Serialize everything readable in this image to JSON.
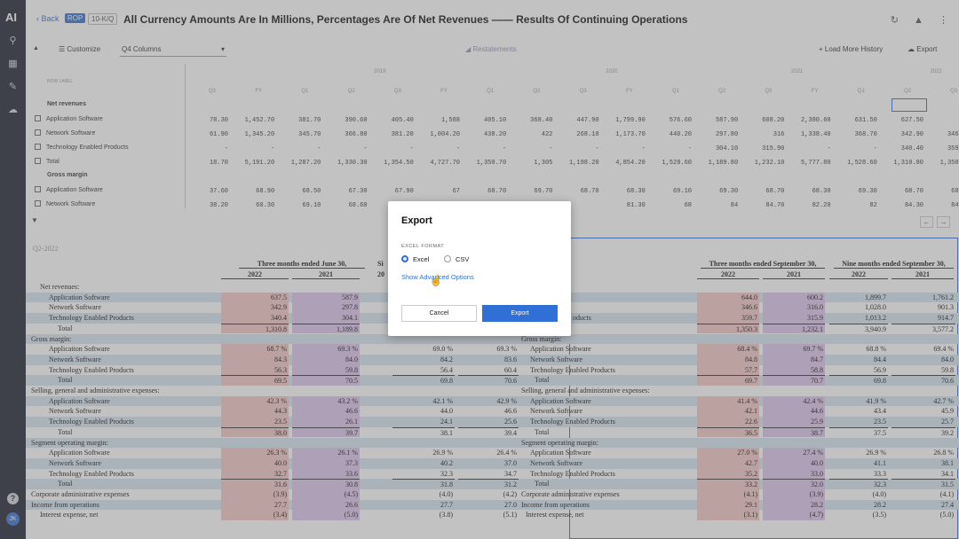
{
  "rail": {
    "logo": "AI",
    "avatar": "JK",
    "help": "?"
  },
  "topbar": {
    "back": "Back",
    "badge1": "ROP",
    "badge2": "10-K/Q",
    "title": "All Currency Amounts Are In Millions, Percentages Are Of Net Revenues —— Results Of Continuing Operations"
  },
  "toolbar": {
    "customize": "Customize",
    "columns": "Q4 Columns",
    "restatements": "Restatements",
    "load_history": "Load More History",
    "export": "Export"
  },
  "grid": {
    "row_label_header": "ROW LABEL",
    "years": [
      "2019",
      "2020",
      "2021",
      "2022"
    ],
    "period_headers": [
      "Q3",
      "FY",
      "Q1",
      "Q2",
      "Q3",
      "FY",
      "Q1",
      "Q2",
      "Q3",
      "FY",
      "Q1",
      "Q2",
      "Q3",
      "FY",
      "Q1",
      "Q2",
      "Q3"
    ],
    "rows": [
      {
        "label": "Net revenues",
        "header": true,
        "cells": []
      },
      {
        "label": "Application Software",
        "header": false,
        "cells": [
          "78.30",
          "1,452.70",
          "381.70",
          "390.60",
          "405.40",
          "1,588",
          "405.10",
          "368.40",
          "447.90",
          "1,799.90",
          "576.60",
          "587.90",
          "608.20",
          "2,380.60",
          "631.50",
          "627.50",
          "644"
        ]
      },
      {
        "label": "Network Software",
        "header": false,
        "cells": [
          "61.90",
          "1,345.20",
          "345.70",
          "366.80",
          "381.20",
          "1,004.20",
          "438.20",
          "422",
          "268.10",
          "1,173.70",
          "440.20",
          "297.80",
          "316",
          "1,338.40",
          "368.70",
          "342.90",
          "346.60"
        ]
      },
      {
        "label": "Technology Enabled Products",
        "header": false,
        "cells": [
          "-",
          "-",
          "-",
          "-",
          "-",
          "-",
          "-",
          "-",
          "-",
          "-",
          "-",
          "304.10",
          "315.90",
          "-",
          "-",
          "340.40",
          "359.70"
        ]
      },
      {
        "label": "Total",
        "header": false,
        "cells": [
          "18.70",
          "5,191.20",
          "1,287.20",
          "1,330.30",
          "1,354.50",
          "4,727.70",
          "1,350.70",
          "1,305",
          "1,198.20",
          "4,854.20",
          "1,528.60",
          "1,189.80",
          "1,232.10",
          "5,777.80",
          "1,528.60",
          "1,310.80",
          "1,350.30"
        ]
      },
      {
        "label": "Gross margin",
        "header": true,
        "cells": []
      },
      {
        "label": "Application Software",
        "header": false,
        "cells": [
          "37.60",
          "68.90",
          "68.50",
          "67.30",
          "67.90",
          "67",
          "68.70",
          "69.70",
          "68.70",
          "68.30",
          "69.10",
          "69.30",
          "68.70",
          "68.30",
          "69.30",
          "68.70",
          "68.40"
        ]
      },
      {
        "label": "Network Software",
        "header": false,
        "cells": [
          "38.20",
          "60.30",
          "69.10",
          "68.60",
          "69.50",
          "",
          "",
          "",
          "",
          "81.30",
          "68",
          "84",
          "84.70",
          "82.20",
          "82",
          "84.30",
          "84.80"
        ]
      }
    ]
  },
  "doc": {
    "period_label": "Q2-2022",
    "hdr_left_3m": "Three months ended June 30,",
    "hdr_left_6m": "Si",
    "hdr_right_3m": "Three months ended September 30,",
    "hdr_right_9m": "Nine months ended September 30,",
    "yr_2022": "2022",
    "yr_2021": "2021",
    "yr_20": "20",
    "rows": [
      {
        "label": "Net revenues:",
        "indent": 1,
        "kind": "sec",
        "c": [
          "",
          "",
          "",
          "",
          "",
          "",
          "",
          ""
        ]
      },
      {
        "label": "Application Software",
        "indent": 2,
        "kind": "row",
        "c": [
          "637.5",
          "587.9",
          "",
          "",
          "644.0",
          "600.2",
          "1,899.7",
          "1,761.2"
        ],
        "d": true
      },
      {
        "label": "Network Software",
        "indent": 2,
        "kind": "row",
        "c": [
          "342.9",
          "297.8",
          "",
          "",
          "346.6",
          "316.0",
          "1,028.0",
          "901.3"
        ]
      },
      {
        "label": "Technology Enabled Products",
        "indent": 2,
        "kind": "row",
        "c": [
          "340.4",
          "304.1",
          "",
          "",
          "359.7",
          "315.9",
          "1,013.2",
          "914.7"
        ]
      },
      {
        "label": "Total",
        "indent": 3,
        "kind": "tot",
        "c": [
          "1,310.8",
          "1,189.8",
          "",
          "",
          "1,350.3",
          "1,232.1",
          "3,940.9",
          "3,577.2"
        ],
        "d": true
      },
      {
        "label": "Gross margin:",
        "indent": 0,
        "kind": "sec",
        "c": [
          "",
          "",
          "",
          "",
          "",
          "",
          "",
          ""
        ]
      },
      {
        "label": "Application Software",
        "indent": 2,
        "kind": "row",
        "c": [
          "68.7 %",
          "69.3 %",
          "69.0 %",
          "69.3 %",
          "68.4 %",
          "69.7 %",
          "68.8 %",
          "69.4 %"
        ]
      },
      {
        "label": "Network Software",
        "indent": 2,
        "kind": "row",
        "c": [
          "84.3",
          "84.0",
          "84.2",
          "83.6",
          "84.8",
          "84.7",
          "84.4",
          "84.0"
        ]
      },
      {
        "label": "Technology Enabled Products",
        "indent": 2,
        "kind": "row",
        "c": [
          "56.3",
          "59.8",
          "56.4",
          "60.4",
          "57.7",
          "58.8",
          "56.9",
          "59.8"
        ]
      },
      {
        "label": "Total",
        "indent": 3,
        "kind": "tot",
        "c": [
          "69.5",
          "70.5",
          "69.8",
          "70.6",
          "69.7",
          "70.7",
          "69.8",
          "70.6"
        ]
      },
      {
        "label": "Selling, general and administrative expenses:",
        "indent": 0,
        "kind": "sec",
        "c": [
          "",
          "",
          "",
          "",
          "",
          "",
          "",
          ""
        ]
      },
      {
        "label": "Application Software",
        "indent": 2,
        "kind": "row",
        "c": [
          "42.3 %",
          "43.2 %",
          "42.1 %",
          "42.9 %",
          "41.4 %",
          "42.4 %",
          "41.9 %",
          "42.7 %"
        ]
      },
      {
        "label": "Network Software",
        "indent": 2,
        "kind": "row",
        "c": [
          "44.3",
          "46.6",
          "44.0",
          "46.6",
          "42.1",
          "44.6",
          "43.4",
          "45.9"
        ]
      },
      {
        "label": "Technology Enabled Products",
        "indent": 2,
        "kind": "row",
        "c": [
          "23.5",
          "26.1",
          "24.1",
          "25.6",
          "22.6",
          "25.9",
          "23.5",
          "25.7"
        ]
      },
      {
        "label": "Total",
        "indent": 3,
        "kind": "tot",
        "c": [
          "38.0",
          "39.7",
          "38.1",
          "39.4",
          "36.5",
          "38.7",
          "37.5",
          "39.2"
        ]
      },
      {
        "label": "Segment operating margin:",
        "indent": 0,
        "kind": "sec",
        "c": [
          "",
          "",
          "",
          "",
          "",
          "",
          "",
          ""
        ]
      },
      {
        "label": "Application Software",
        "indent": 2,
        "kind": "row",
        "c": [
          "26.3 %",
          "26.1 %",
          "26.9 %",
          "26.4 %",
          "27.0 %",
          "27.4 %",
          "26.9 %",
          "26.8 %"
        ]
      },
      {
        "label": "Network Software",
        "indent": 2,
        "kind": "row",
        "c": [
          "40.0",
          "37.3",
          "40.2",
          "37.0",
          "42.7",
          "40.0",
          "41.1",
          "38.1"
        ]
      },
      {
        "label": "Technology Enabled Products",
        "indent": 2,
        "kind": "row",
        "c": [
          "32.7",
          "33.6",
          "32.3",
          "34.7",
          "35.2",
          "33.0",
          "33.3",
          "34.1"
        ]
      },
      {
        "label": "Total",
        "indent": 3,
        "kind": "tot",
        "c": [
          "31.6",
          "30.8",
          "31.8",
          "31.2",
          "33.2",
          "32.0",
          "32.3",
          "31.5"
        ]
      },
      {
        "label": "Corporate administrative expenses",
        "indent": 0,
        "kind": "row",
        "c": [
          "(3.9)",
          "(4.5)",
          "(4.0)",
          "(4.2)",
          "(4.1)",
          "(3.9)",
          "(4.0)",
          "(4.1)"
        ]
      },
      {
        "label": "Income from operations",
        "indent": 0,
        "kind": "row",
        "c": [
          "27.7",
          "26.6",
          "27.7",
          "27.0",
          "29.1",
          "28.2",
          "28.2",
          "27.4"
        ]
      },
      {
        "label": "Interest expense, net",
        "indent": 1,
        "kind": "row",
        "c": [
          "(3.4)",
          "(5.0)",
          "(3.8)",
          "(5.1)",
          "(3.1)",
          "(4.7)",
          "(3.5)",
          "(5.0)"
        ]
      }
    ],
    "mid_labels": [
      "Gross margin:",
      "Application Software",
      "Network Software",
      "Technology Enabled Products",
      "Total",
      "Selling, general and administrative expenses:",
      "Application Software",
      "Network Software",
      "Technology Enabled Products",
      "Total",
      "Segment operating margin:",
      "Application Software",
      "Network Software",
      "Technology Enabled Products",
      "Total",
      "Corporate administrative expenses",
      "Income from operations",
      "Interest expense, net"
    ],
    "mid_top_label": "oducts"
  },
  "modal": {
    "title": "Export",
    "format_label": "EXCEL FORMAT",
    "opt_excel": "Excel",
    "opt_csv": "CSV",
    "advanced": "Show Advanced Options",
    "cancel": "Cancel",
    "export": "Export"
  }
}
